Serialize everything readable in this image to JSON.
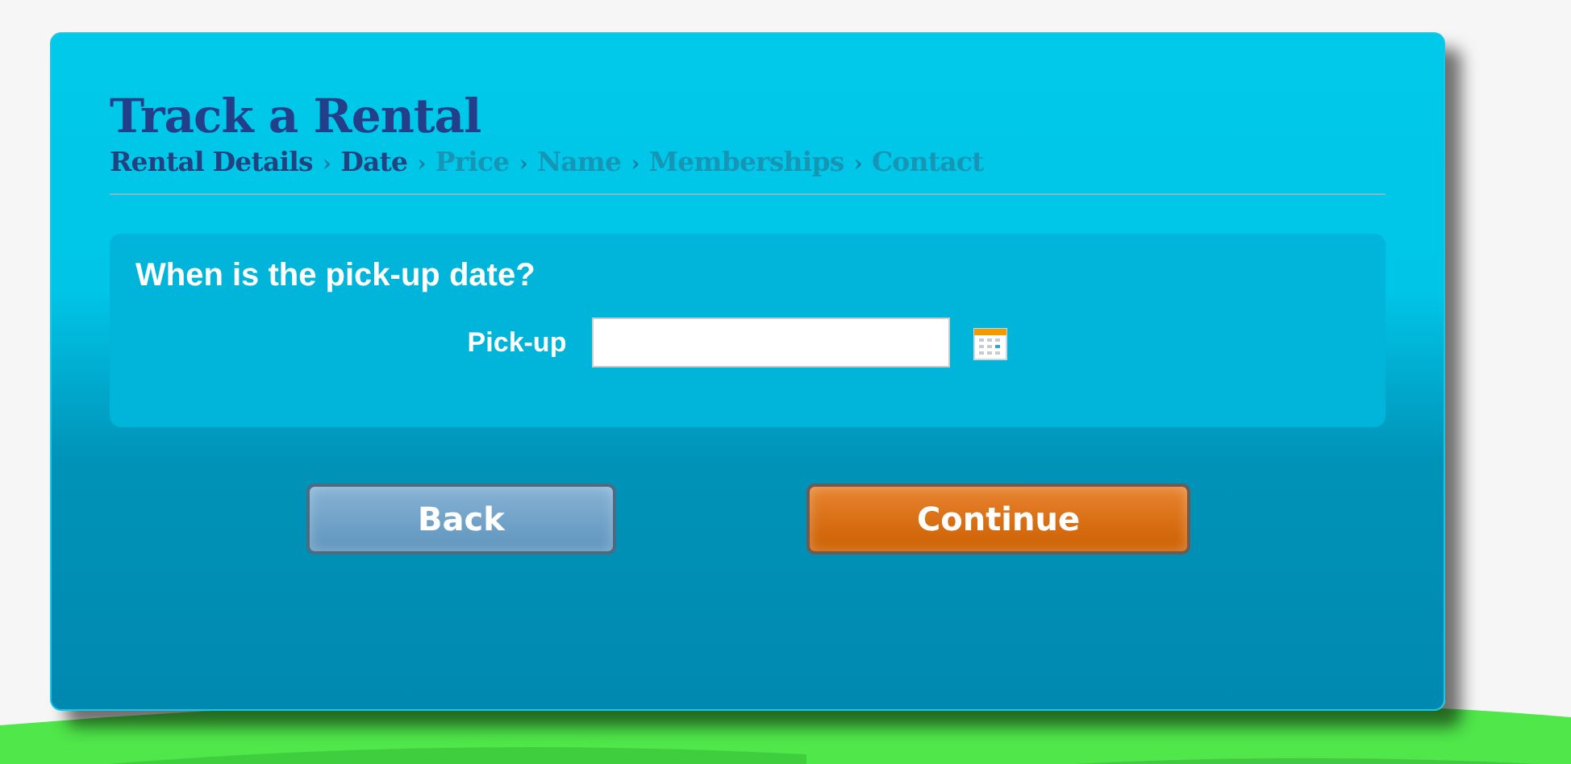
{
  "title": "Track a Rental",
  "steps": [
    {
      "label": "Rental Details",
      "reached": true
    },
    {
      "label": "Date",
      "reached": true
    },
    {
      "label": "Price",
      "reached": false
    },
    {
      "label": "Name",
      "reached": false
    },
    {
      "label": "Memberships",
      "reached": false
    },
    {
      "label": "Contact",
      "reached": false
    }
  ],
  "separator": "›",
  "question": "When is the pick-up date?",
  "field": {
    "label": "Pick-up"
  },
  "buttons": [
    {
      "label": "Back",
      "kind": "secondary"
    },
    {
      "label": "Continue",
      "kind": "primary"
    }
  ]
}
